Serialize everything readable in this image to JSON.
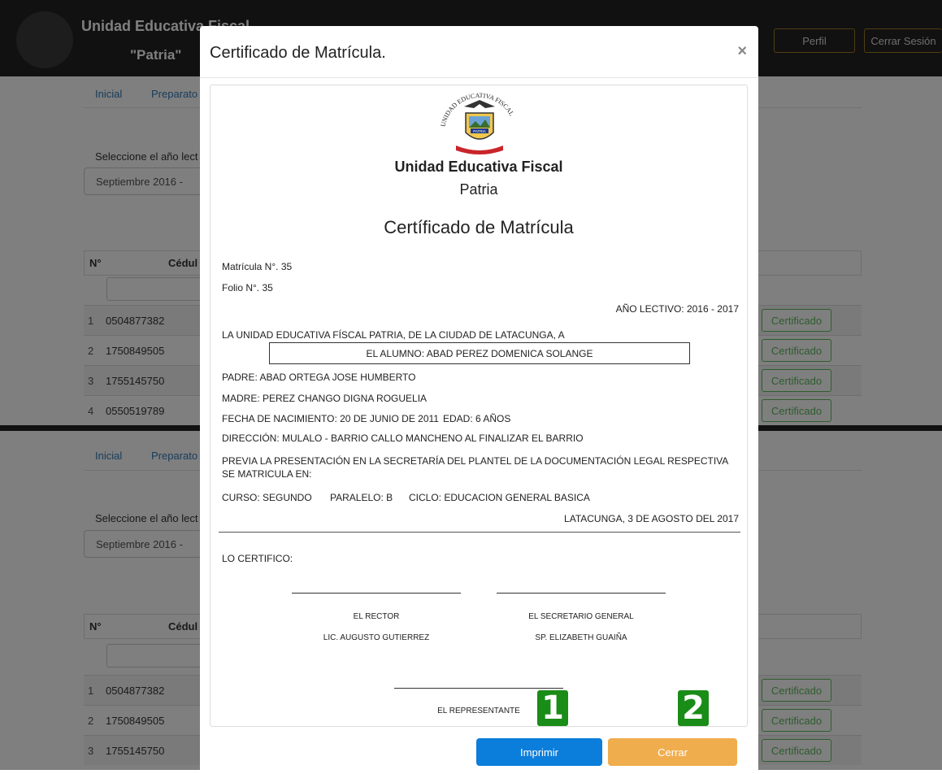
{
  "header": {
    "school_line1": "Unidad Educativa Fiscal",
    "school_line2": "\"Patria\"",
    "profile_button": "Perfil",
    "logout_button": "Cerrar Sesión",
    "logo_icon": "school-crest-logo"
  },
  "nav": {
    "tab1": "Inicial",
    "tab2": "Preparato"
  },
  "form": {
    "year_label": "Seleccione el año lect",
    "year_value": "Septiembre 2016 -"
  },
  "table": {
    "col_num": "N°",
    "col_cedula": "Cédul",
    "cert_button": "Certificado",
    "rows_top": [
      {
        "num": "1",
        "cedula": "0504877382"
      },
      {
        "num": "2",
        "cedula": "1750849505"
      },
      {
        "num": "3",
        "cedula": "1755145750"
      },
      {
        "num": "4",
        "cedula": "0550519789"
      }
    ],
    "rows_bottom": [
      {
        "num": "1",
        "cedula": "0504877382"
      },
      {
        "num": "2",
        "cedula": "1750849505"
      },
      {
        "num": "3",
        "cedula": "1755145750"
      }
    ]
  },
  "modal": {
    "title": "Certificado de Matrícula.",
    "close_icon": "×",
    "print_button": "Imprimir",
    "close_button": "Cerrar"
  },
  "certificate": {
    "logo_arc": "UNIDAD EDUCATIVA FISCAL",
    "logo_band": "PATRIA",
    "school_name": "Unidad Educativa Fiscal",
    "school_sub": "Patria",
    "heading": "Certíficado de Matrícula",
    "matricula": "Matrícula N°. 35",
    "folio": "Folio N°. 35",
    "anio_lectivo": "AÑO LECTIVO: 2016 - 2017",
    "intro": "LA UNIDAD EDUCATIVA FÍSCAL PATRIA, DE LA CIUDAD DE LATACUNGA, A",
    "alumno": "EL ALUMNO: ABAD PEREZ DOMENICA SOLANGE",
    "padre": "PADRE: ABAD ORTEGA JOSE HUMBERTO",
    "madre": "MADRE: PEREZ CHANGO DIGNA ROGUELIA",
    "nacimiento": "FECHA DE NACIMIENTO: 20 DE JUNIO DE 2011",
    "edad": "EDAD: 6 AÑOS",
    "direccion": "DIRECCIÓN: MULALO - BARRIO CALLO MANCHENO AL FINALIZAR EL BARRIO",
    "previa_1": "PREVIA LA PRESENTACIÓN EN LA SECRETARÍA DEL PLANTEL DE LA DOCUMENTACIÓN LEGAL RESPECTIVA",
    "previa_2": "SE MATRICULA EN:",
    "curso": "CURSO: SEGUNDO",
    "paralelo": "PARALELO: B",
    "ciclo": "CICLO: EDUCACION GENERAL BASICA",
    "lugar_fecha": "LATACUNGA, 3 DE AGOSTO DEL 2017",
    "lo_certifico": "LO CERTIFICO:",
    "rector_title": "EL RECTOR",
    "rector_name": "LIC. AUGUSTO GUTIERREZ",
    "secretario_title": "EL SECRETARIO GENERAL",
    "secretario_name": "SP. ELIZABETH GUAIÑA",
    "representante": "EL REPRESENTANTE"
  },
  "markers": {
    "m1": "1",
    "m2": "2",
    "color": "#1a8c18"
  },
  "colors": {
    "navbar": "#222222",
    "primary": "#0b7ddb",
    "warning": "#f0ad4e",
    "success": "#5cb85c",
    "link": "#337ab7"
  }
}
